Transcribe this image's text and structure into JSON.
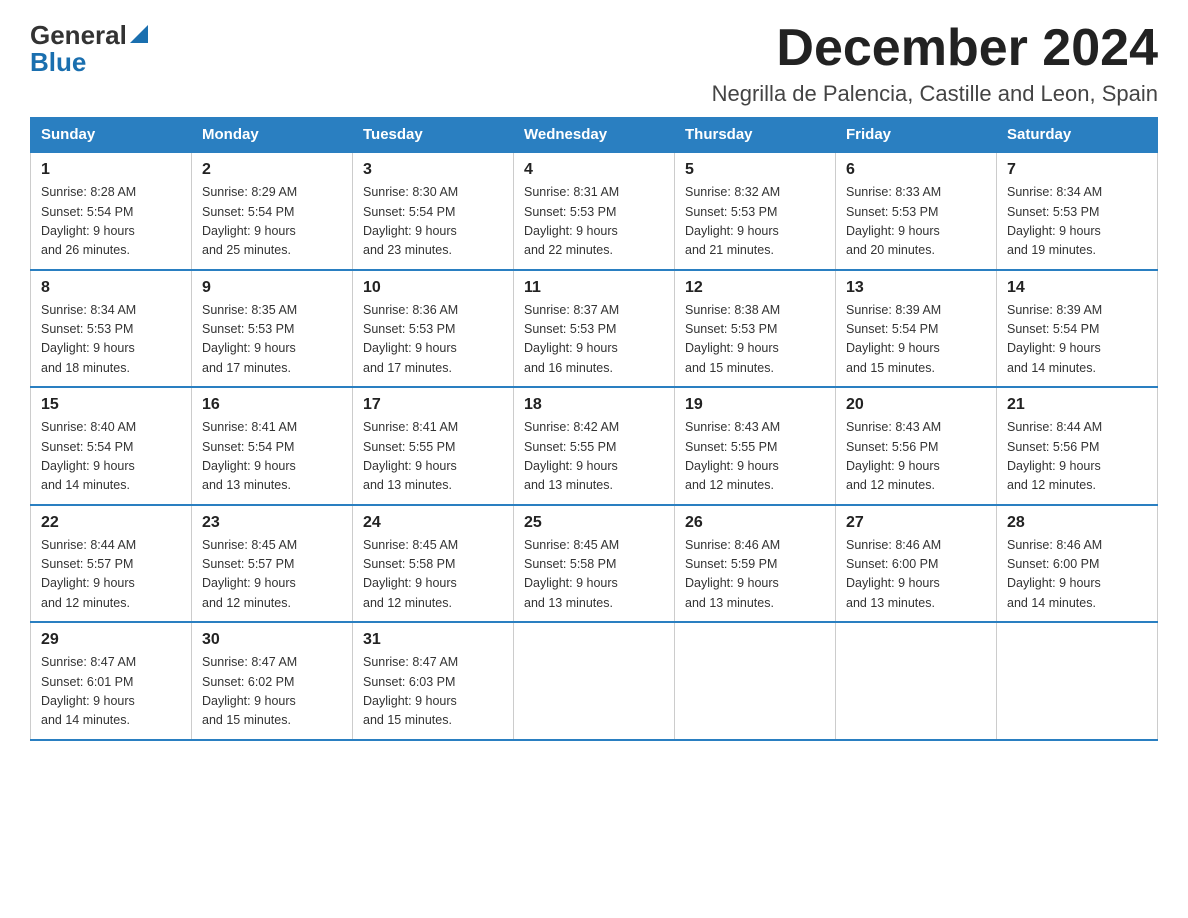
{
  "header": {
    "month_title": "December 2024",
    "location": "Negrilla de Palencia, Castille and Leon, Spain",
    "logo_general": "General",
    "logo_blue": "Blue"
  },
  "weekdays": [
    "Sunday",
    "Monday",
    "Tuesday",
    "Wednesday",
    "Thursday",
    "Friday",
    "Saturday"
  ],
  "weeks": [
    [
      {
        "day": "1",
        "sunrise": "8:28 AM",
        "sunset": "5:54 PM",
        "daylight": "9 hours and 26 minutes."
      },
      {
        "day": "2",
        "sunrise": "8:29 AM",
        "sunset": "5:54 PM",
        "daylight": "9 hours and 25 minutes."
      },
      {
        "day": "3",
        "sunrise": "8:30 AM",
        "sunset": "5:54 PM",
        "daylight": "9 hours and 23 minutes."
      },
      {
        "day": "4",
        "sunrise": "8:31 AM",
        "sunset": "5:53 PM",
        "daylight": "9 hours and 22 minutes."
      },
      {
        "day": "5",
        "sunrise": "8:32 AM",
        "sunset": "5:53 PM",
        "daylight": "9 hours and 21 minutes."
      },
      {
        "day": "6",
        "sunrise": "8:33 AM",
        "sunset": "5:53 PM",
        "daylight": "9 hours and 20 minutes."
      },
      {
        "day": "7",
        "sunrise": "8:34 AM",
        "sunset": "5:53 PM",
        "daylight": "9 hours and 19 minutes."
      }
    ],
    [
      {
        "day": "8",
        "sunrise": "8:34 AM",
        "sunset": "5:53 PM",
        "daylight": "9 hours and 18 minutes."
      },
      {
        "day": "9",
        "sunrise": "8:35 AM",
        "sunset": "5:53 PM",
        "daylight": "9 hours and 17 minutes."
      },
      {
        "day": "10",
        "sunrise": "8:36 AM",
        "sunset": "5:53 PM",
        "daylight": "9 hours and 17 minutes."
      },
      {
        "day": "11",
        "sunrise": "8:37 AM",
        "sunset": "5:53 PM",
        "daylight": "9 hours and 16 minutes."
      },
      {
        "day": "12",
        "sunrise": "8:38 AM",
        "sunset": "5:53 PM",
        "daylight": "9 hours and 15 minutes."
      },
      {
        "day": "13",
        "sunrise": "8:39 AM",
        "sunset": "5:54 PM",
        "daylight": "9 hours and 15 minutes."
      },
      {
        "day": "14",
        "sunrise": "8:39 AM",
        "sunset": "5:54 PM",
        "daylight": "9 hours and 14 minutes."
      }
    ],
    [
      {
        "day": "15",
        "sunrise": "8:40 AM",
        "sunset": "5:54 PM",
        "daylight": "9 hours and 14 minutes."
      },
      {
        "day": "16",
        "sunrise": "8:41 AM",
        "sunset": "5:54 PM",
        "daylight": "9 hours and 13 minutes."
      },
      {
        "day": "17",
        "sunrise": "8:41 AM",
        "sunset": "5:55 PM",
        "daylight": "9 hours and 13 minutes."
      },
      {
        "day": "18",
        "sunrise": "8:42 AM",
        "sunset": "5:55 PM",
        "daylight": "9 hours and 13 minutes."
      },
      {
        "day": "19",
        "sunrise": "8:43 AM",
        "sunset": "5:55 PM",
        "daylight": "9 hours and 12 minutes."
      },
      {
        "day": "20",
        "sunrise": "8:43 AM",
        "sunset": "5:56 PM",
        "daylight": "9 hours and 12 minutes."
      },
      {
        "day": "21",
        "sunrise": "8:44 AM",
        "sunset": "5:56 PM",
        "daylight": "9 hours and 12 minutes."
      }
    ],
    [
      {
        "day": "22",
        "sunrise": "8:44 AM",
        "sunset": "5:57 PM",
        "daylight": "9 hours and 12 minutes."
      },
      {
        "day": "23",
        "sunrise": "8:45 AM",
        "sunset": "5:57 PM",
        "daylight": "9 hours and 12 minutes."
      },
      {
        "day": "24",
        "sunrise": "8:45 AM",
        "sunset": "5:58 PM",
        "daylight": "9 hours and 12 minutes."
      },
      {
        "day": "25",
        "sunrise": "8:45 AM",
        "sunset": "5:58 PM",
        "daylight": "9 hours and 13 minutes."
      },
      {
        "day": "26",
        "sunrise": "8:46 AM",
        "sunset": "5:59 PM",
        "daylight": "9 hours and 13 minutes."
      },
      {
        "day": "27",
        "sunrise": "8:46 AM",
        "sunset": "6:00 PM",
        "daylight": "9 hours and 13 minutes."
      },
      {
        "day": "28",
        "sunrise": "8:46 AM",
        "sunset": "6:00 PM",
        "daylight": "9 hours and 14 minutes."
      }
    ],
    [
      {
        "day": "29",
        "sunrise": "8:47 AM",
        "sunset": "6:01 PM",
        "daylight": "9 hours and 14 minutes."
      },
      {
        "day": "30",
        "sunrise": "8:47 AM",
        "sunset": "6:02 PM",
        "daylight": "9 hours and 15 minutes."
      },
      {
        "day": "31",
        "sunrise": "8:47 AM",
        "sunset": "6:03 PM",
        "daylight": "9 hours and 15 minutes."
      },
      null,
      null,
      null,
      null
    ]
  ],
  "labels": {
    "sunrise": "Sunrise:",
    "sunset": "Sunset:",
    "daylight": "Daylight:"
  }
}
